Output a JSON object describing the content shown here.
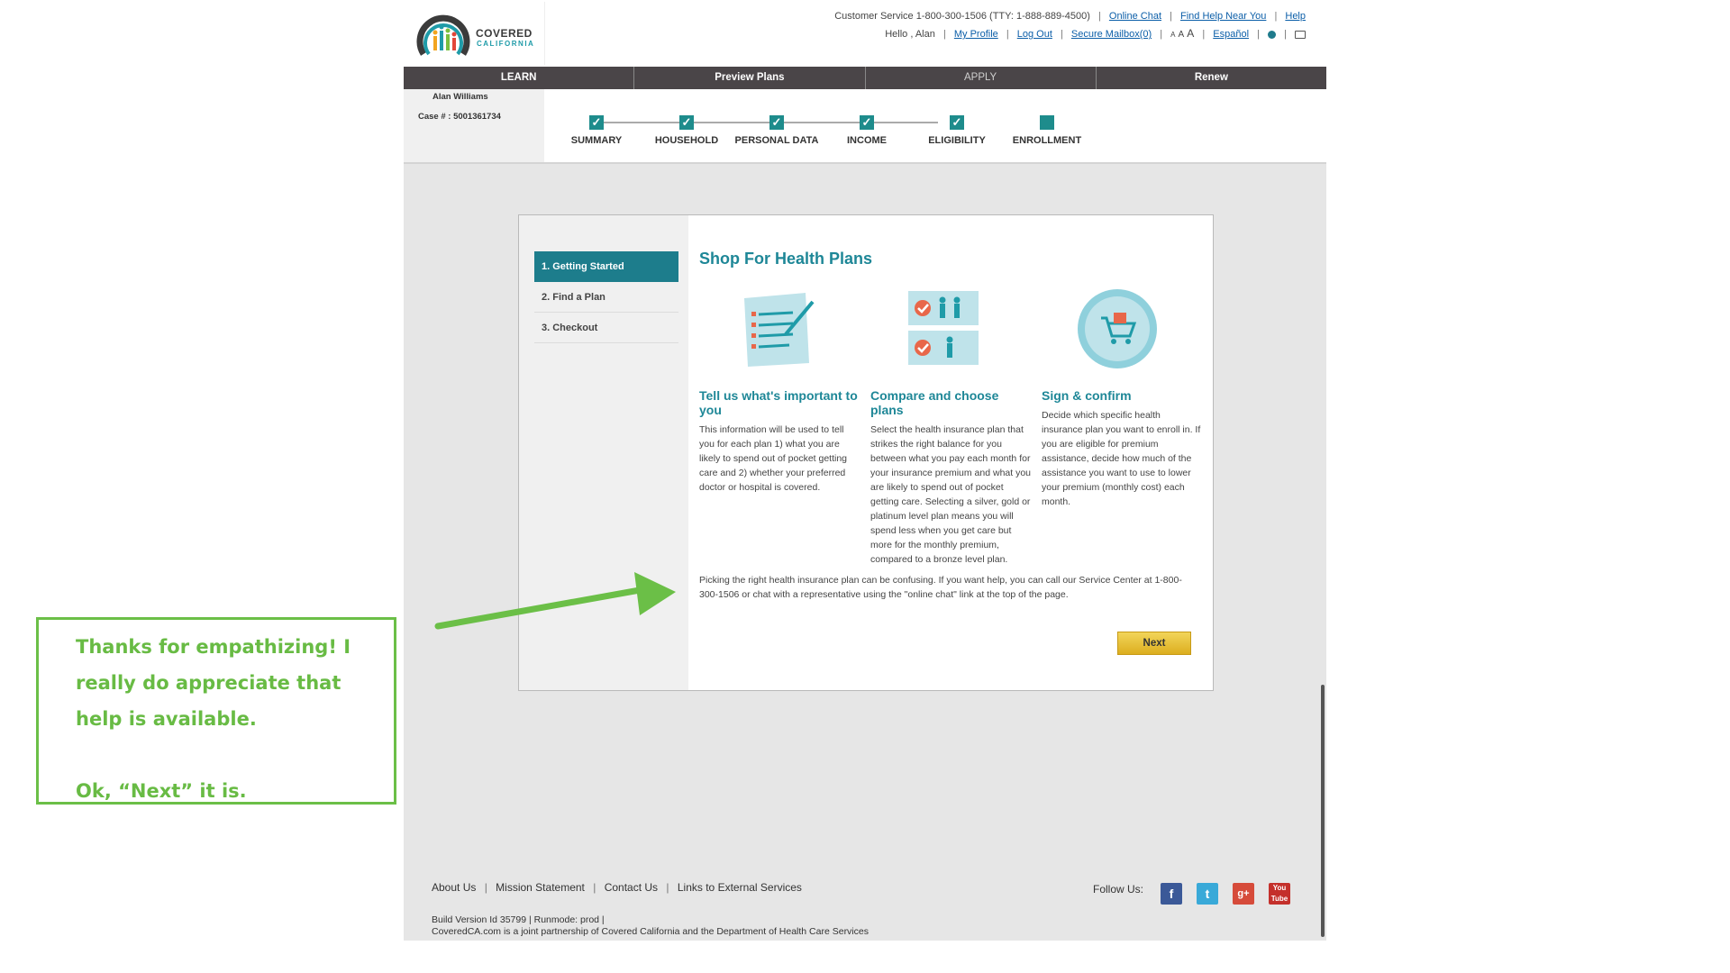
{
  "header": {
    "logo": {
      "line1": "COVERED",
      "line2": "CALIFORNIA"
    },
    "customer_service": "Customer Service 1-800-300-1506 (TTY: 1-888-889-4500)",
    "links_row1": [
      "Online Chat",
      "Find Help Near You",
      "Help"
    ],
    "greeting": "Hello , Alan",
    "links_row2": [
      "My Profile",
      "Log Out",
      "Secure Mailbox(0)"
    ],
    "font_sizes": [
      "A",
      "A",
      "A"
    ],
    "language": "Español"
  },
  "nav": {
    "tabs": [
      "LEARN",
      "Preview Plans",
      "APPLY",
      "Renew"
    ]
  },
  "user": {
    "name": "Alan Williams",
    "case": "Case # : 5001361734"
  },
  "progress": {
    "steps": [
      "SUMMARY",
      "HOUSEHOLD",
      "PERSONAL DATA",
      "INCOME",
      "ELIGIBILITY",
      "ENROLLMENT"
    ],
    "check": "✓",
    "accent": "#1e8c8c"
  },
  "sidebar": {
    "items": [
      "1.  Getting Started",
      "2.  Find a Plan",
      "3.  Checkout"
    ]
  },
  "main": {
    "title": "Shop For Health Plans",
    "columns": [
      {
        "title": "Tell us what's important to you",
        "text": "This information will be used to tell you for each plan 1) what you are likely to spend out of pocket getting care and 2) whether your preferred doctor or hospital is covered."
      },
      {
        "title": "Compare and choose plans",
        "text": "Select the health insurance plan that strikes the right balance for you between what you pay each month for your insurance premium and what you are likely to spend out of pocket getting care. Selecting a silver, gold or platinum level plan means you will spend less when you get care but more for the monthly premium, compared to a bronze level plan."
      },
      {
        "title": "Sign & confirm",
        "text": "Decide which specific health insurance plan you want to enroll in. If you are eligible for premium assistance, decide how much of the assistance you want to use to lower your premium (monthly cost) each month."
      }
    ],
    "help_text": "Picking the right health insurance plan can be confusing. If you want help, you can call our Service Center at 1-800-300-1506 or chat with a representative using the \"online chat\" link at the top of the page.",
    "next_label": "Next"
  },
  "footer": {
    "links": [
      "About Us",
      "Mission Statement",
      "Contact Us",
      "Links to External Services"
    ],
    "follow": "Follow Us:",
    "social": [
      "facebook-icon",
      "twitter-icon",
      "google-plus-icon",
      "youtube-icon"
    ],
    "build": "Build Version Id 35799  |    Runmode: prod  |",
    "partner": "CoveredCA.com is a joint partnership of Covered California and the Department of Health Care Services"
  },
  "annotation": {
    "text": "Thanks for empathizing! I really do appreciate that help is available.\n\nOk, “Next” it is.",
    "color": "#6bbf47"
  }
}
